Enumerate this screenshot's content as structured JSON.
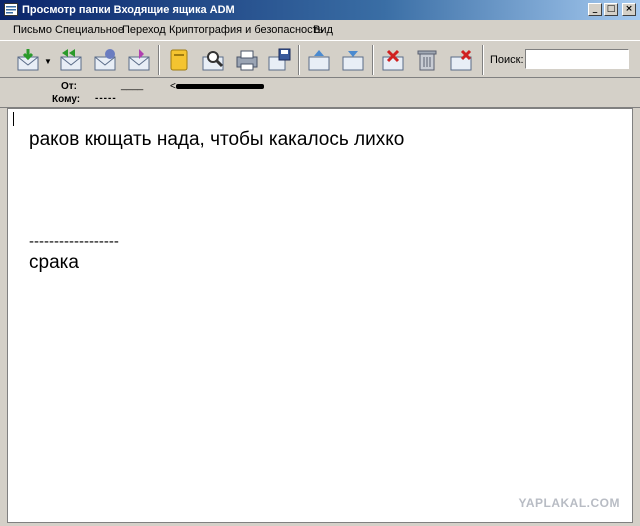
{
  "window": {
    "title": "Просмотр папки Входящие ящика ADM",
    "minimize": "_",
    "maximize": "□",
    "close": "×"
  },
  "menu": [
    "Письмо",
    "Специальное",
    "Переход",
    "Криптография и безопасность",
    "Вид"
  ],
  "toolbar": {
    "search_label": "Поиск:",
    "search_value": "",
    "icons": [
      "get-mail-icon",
      "reply-all-icon",
      "forward-icon",
      "new-message-icon",
      "address-book-icon",
      "find-icon",
      "print-icon",
      "save-icon",
      "move-up-icon",
      "move-down-icon",
      "mark-spam-icon",
      "trash-icon",
      "delete-icon"
    ]
  },
  "headers": {
    "from_label": "От:",
    "from_value": "____",
    "from_email_start": "<",
    "to_label": "Кому:",
    "to_value": "-----"
  },
  "message": {
    "line1": "раков кющать нада, чтобы какалось лихко",
    "separator": "------------------",
    "signature": "срака"
  },
  "watermark": "YAPLAKAL.COM"
}
